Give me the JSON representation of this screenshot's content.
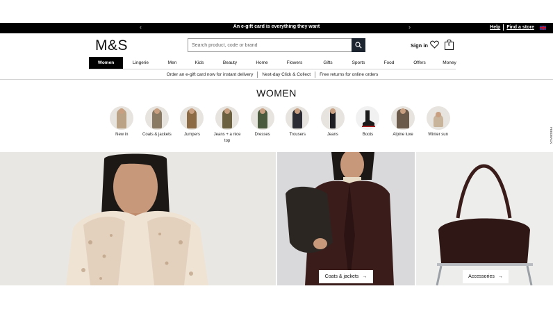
{
  "promo": {
    "text": "An e-gift card is everything they want",
    "help": "Help",
    "find_store": "Find a store"
  },
  "header": {
    "logo": "M&S",
    "search_placeholder": "Search product, code or brand",
    "signin": "Sign in",
    "basket_count": "0"
  },
  "nav": [
    {
      "label": "Women",
      "active": true
    },
    {
      "label": "Lingerie"
    },
    {
      "label": "Men"
    },
    {
      "label": "Kids"
    },
    {
      "label": "Beauty"
    },
    {
      "label": "Home"
    },
    {
      "label": "Flowers"
    },
    {
      "label": "Gifts"
    },
    {
      "label": "Sports"
    },
    {
      "label": "Food"
    },
    {
      "label": "Offers"
    },
    {
      "label": "Money"
    }
  ],
  "services": [
    "Order an e-gift card now for instant delivery",
    "Next-day Click & Collect",
    "Free returns for online orders"
  ],
  "page_title": "WOMEN",
  "categories": [
    {
      "label": "New in",
      "color": "#b9a286"
    },
    {
      "label": "Coats & jackets",
      "color": "#8a7a63"
    },
    {
      "label": "Jumpers",
      "color": "#8c6a44"
    },
    {
      "label": "Jeans + a nice top",
      "color": "#6b6140"
    },
    {
      "label": "Dresses",
      "color": "#4a5a3c"
    },
    {
      "label": "Trousers",
      "color": "#2c2c34"
    },
    {
      "label": "Jeans",
      "color": "#1d1d22"
    },
    {
      "label": "Boots",
      "color": "#a01e1e"
    },
    {
      "label": "Alpine luxe",
      "color": "#6b5a4a"
    },
    {
      "label": "Winter sun",
      "color": "#c8b49a"
    }
  ],
  "feedback_label": "FEEDBACK",
  "hero_ctas": {
    "coats": "Coats & jackets",
    "accessories": "Accessories"
  }
}
